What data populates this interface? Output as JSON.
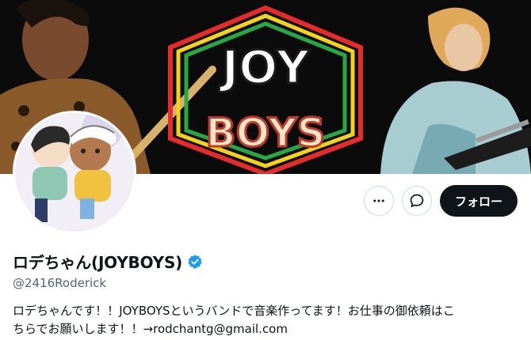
{
  "profile": {
    "banner_logo_text_top": "JOY",
    "banner_logo_text_bottom": "BOYS",
    "display_name": "ロデちゃん(JOYBOYS)",
    "handle": "@2416Roderick",
    "bio_line1": "ロデちゃんです！！JOYBOYSというバンドで音楽作ってます！お仕事の御依頼はこ",
    "bio_line2": "ちらでお願いします！！→rodchantg@gmail.com",
    "verified": true
  },
  "actions": {
    "more_icon": "more-horizontal-icon",
    "message_icon": "message-icon",
    "follow_label": "フォロー"
  },
  "colors": {
    "verified_badge": "#1d9bf0",
    "follow_button_bg": "#0f1419",
    "handle_text": "#536471"
  }
}
